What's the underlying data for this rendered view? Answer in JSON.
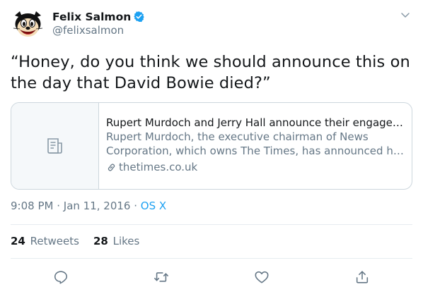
{
  "user": {
    "display_name": "Felix Salmon",
    "handle": "@felixsalmon",
    "verified": true
  },
  "tweet": {
    "text": "“Honey, do you think we should announce this on the day that David Bowie died?”"
  },
  "card": {
    "title": "Rupert Murdoch and Jerry Hall announce their engagement",
    "description_line1": "Rupert Murdoch, the executive chairman of News",
    "description_line2": "Corporation, which owns The Times, has announced his engagement",
    "domain": "thetimes.co.uk",
    "thumb_icon": "article-icon"
  },
  "meta": {
    "time": "9:08 PM",
    "sep1": " · ",
    "date": "Jan 11, 2016",
    "sep2": " · ",
    "app": "OS X"
  },
  "stats": {
    "retweets_count": "24",
    "retweets_label": "Retweets",
    "likes_count": "28",
    "likes_label": "Likes"
  },
  "actions": [
    "reply-icon",
    "retweet-icon",
    "like-icon",
    "share-icon"
  ],
  "colors": {
    "accent": "#1da1f2",
    "text": "#14171a",
    "secondary": "#657786",
    "border": "#ccd6dd"
  }
}
